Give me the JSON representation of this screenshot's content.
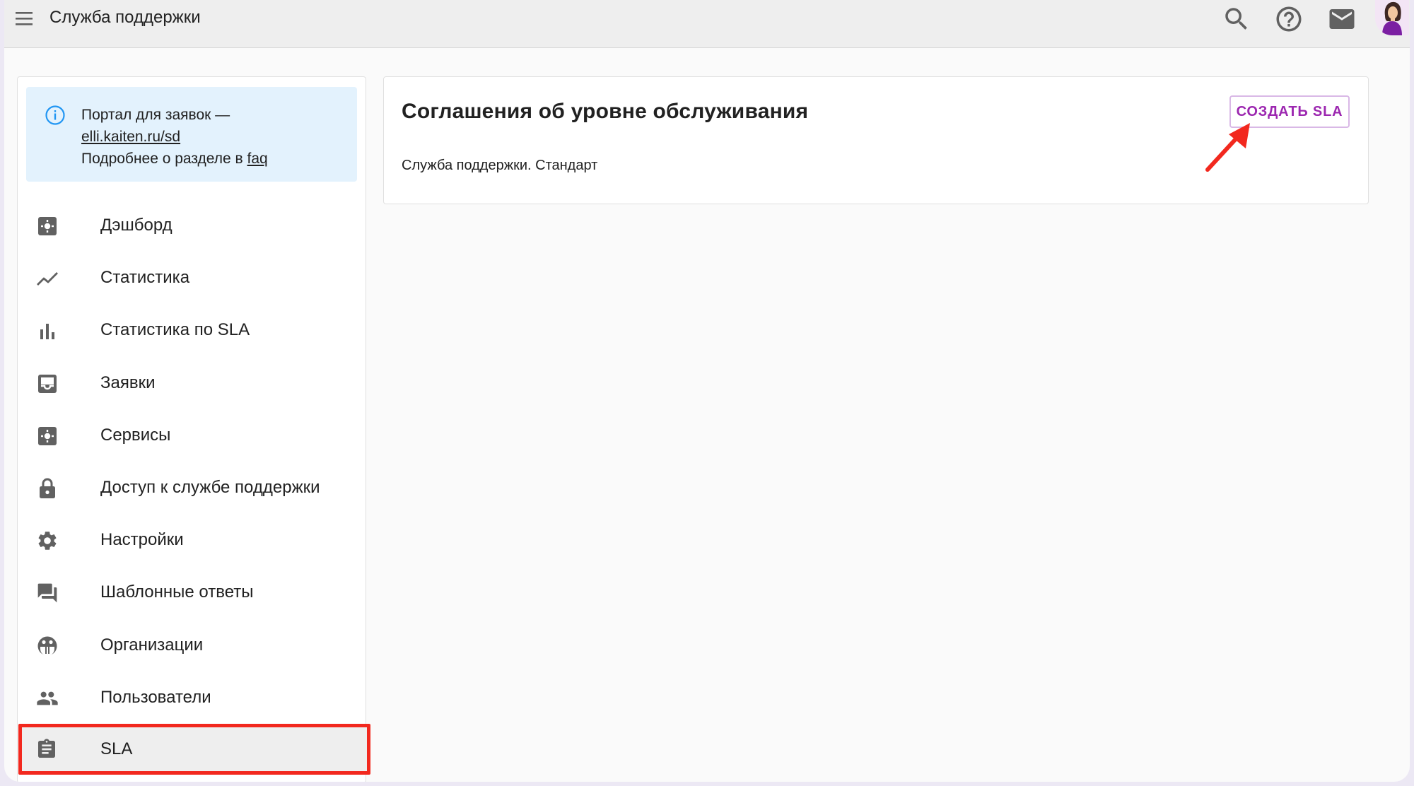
{
  "header": {
    "title": "Служба поддержки",
    "icons": [
      "menu-icon",
      "search-icon",
      "help-icon",
      "mail-icon",
      "avatar"
    ]
  },
  "info": {
    "line1": "Портал для заявок —",
    "link": "elli.kaiten.ru/sd",
    "line3_prefix": "Подробнее о разделе в ",
    "faq": "faq"
  },
  "sidebar": {
    "items": [
      {
        "label": "Дэшборд",
        "icon": "dashboard-icon"
      },
      {
        "label": "Статистика",
        "icon": "trending-icon"
      },
      {
        "label": "Статистика по SLA",
        "icon": "bar-chart-icon"
      },
      {
        "label": "Заявки",
        "icon": "inbox-icon"
      },
      {
        "label": "Сервисы",
        "icon": "services-icon"
      },
      {
        "label": "Доступ к службе поддержки",
        "icon": "lock-icon"
      },
      {
        "label": "Настройки",
        "icon": "gear-icon"
      },
      {
        "label": "Шаблонные ответы",
        "icon": "forum-icon"
      },
      {
        "label": "Организации",
        "icon": "organization-icon"
      },
      {
        "label": "Пользователи",
        "icon": "users-icon"
      },
      {
        "label": "SLA",
        "icon": "clipboard-icon",
        "selected": true
      }
    ]
  },
  "main": {
    "title": "Соглашения об уровне обслуживания",
    "create_button": "СОЗДАТЬ SLA",
    "sla_items": [
      "Служба поддержки. Стандарт"
    ]
  },
  "colors": {
    "accent": "#9c27b0",
    "highlight": "#f2281e",
    "info_bg": "#e3f2fd",
    "info_icon": "#2196f3",
    "icon_gray": "#616161"
  }
}
